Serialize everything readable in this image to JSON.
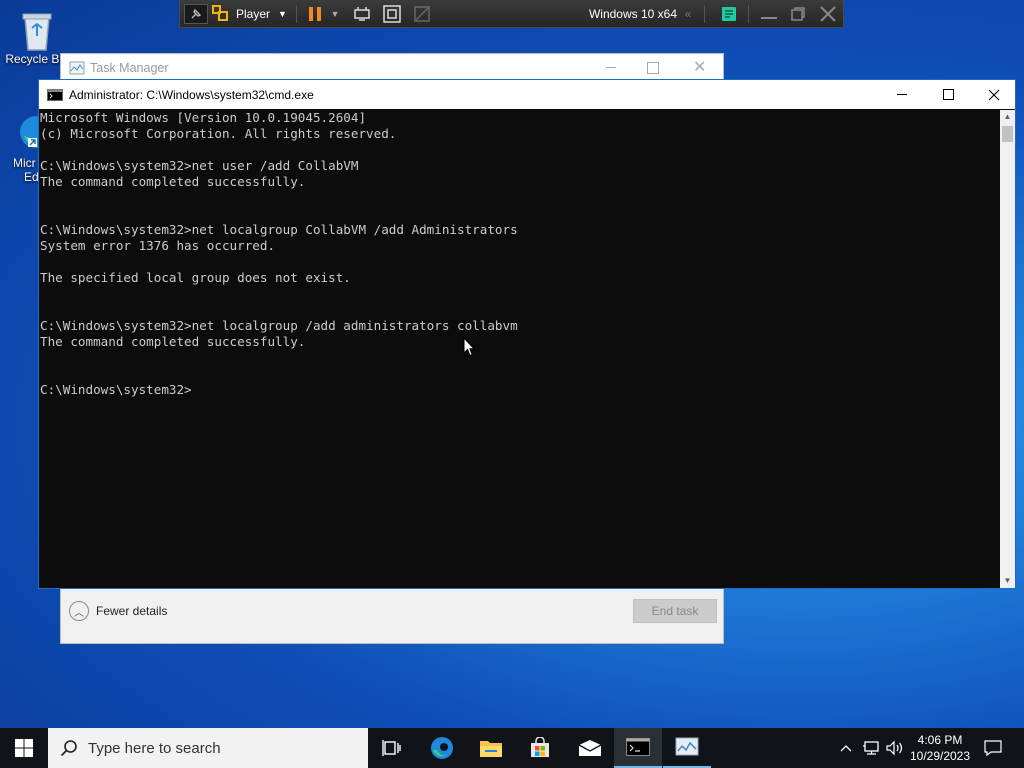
{
  "desktop": {
    "recycle_bin_label": "Recycle Bin",
    "edge_label_line1": "Micr",
    "edge_label_line2": "Ed"
  },
  "vm_toolbar": {
    "player_label": "Player",
    "vm_name": "Windows 10 x64",
    "pause_color": "#f08a24",
    "accent_color": "#22c9a5"
  },
  "task_manager": {
    "title": "Task Manager",
    "fewer_details_label": "Fewer details",
    "end_task_label": "End task"
  },
  "cmd": {
    "title": "Administrator: C:\\Windows\\system32\\cmd.exe",
    "lines": [
      "Microsoft Windows [Version 10.0.19045.2604]",
      "(c) Microsoft Corporation. All rights reserved.",
      "",
      "C:\\Windows\\system32>net user /add CollabVM",
      "The command completed successfully.",
      "",
      "",
      "C:\\Windows\\system32>net localgroup CollabVM /add Administrators",
      "System error 1376 has occurred.",
      "",
      "The specified local group does not exist.",
      "",
      "",
      "C:\\Windows\\system32>net localgroup /add administrators collabvm",
      "The command completed successfully.",
      "",
      "",
      "C:\\Windows\\system32>"
    ]
  },
  "taskbar": {
    "search_placeholder": "Type here to search",
    "time": "4:06 PM",
    "date": "10/29/2023",
    "accent_color": "#0078d7"
  }
}
